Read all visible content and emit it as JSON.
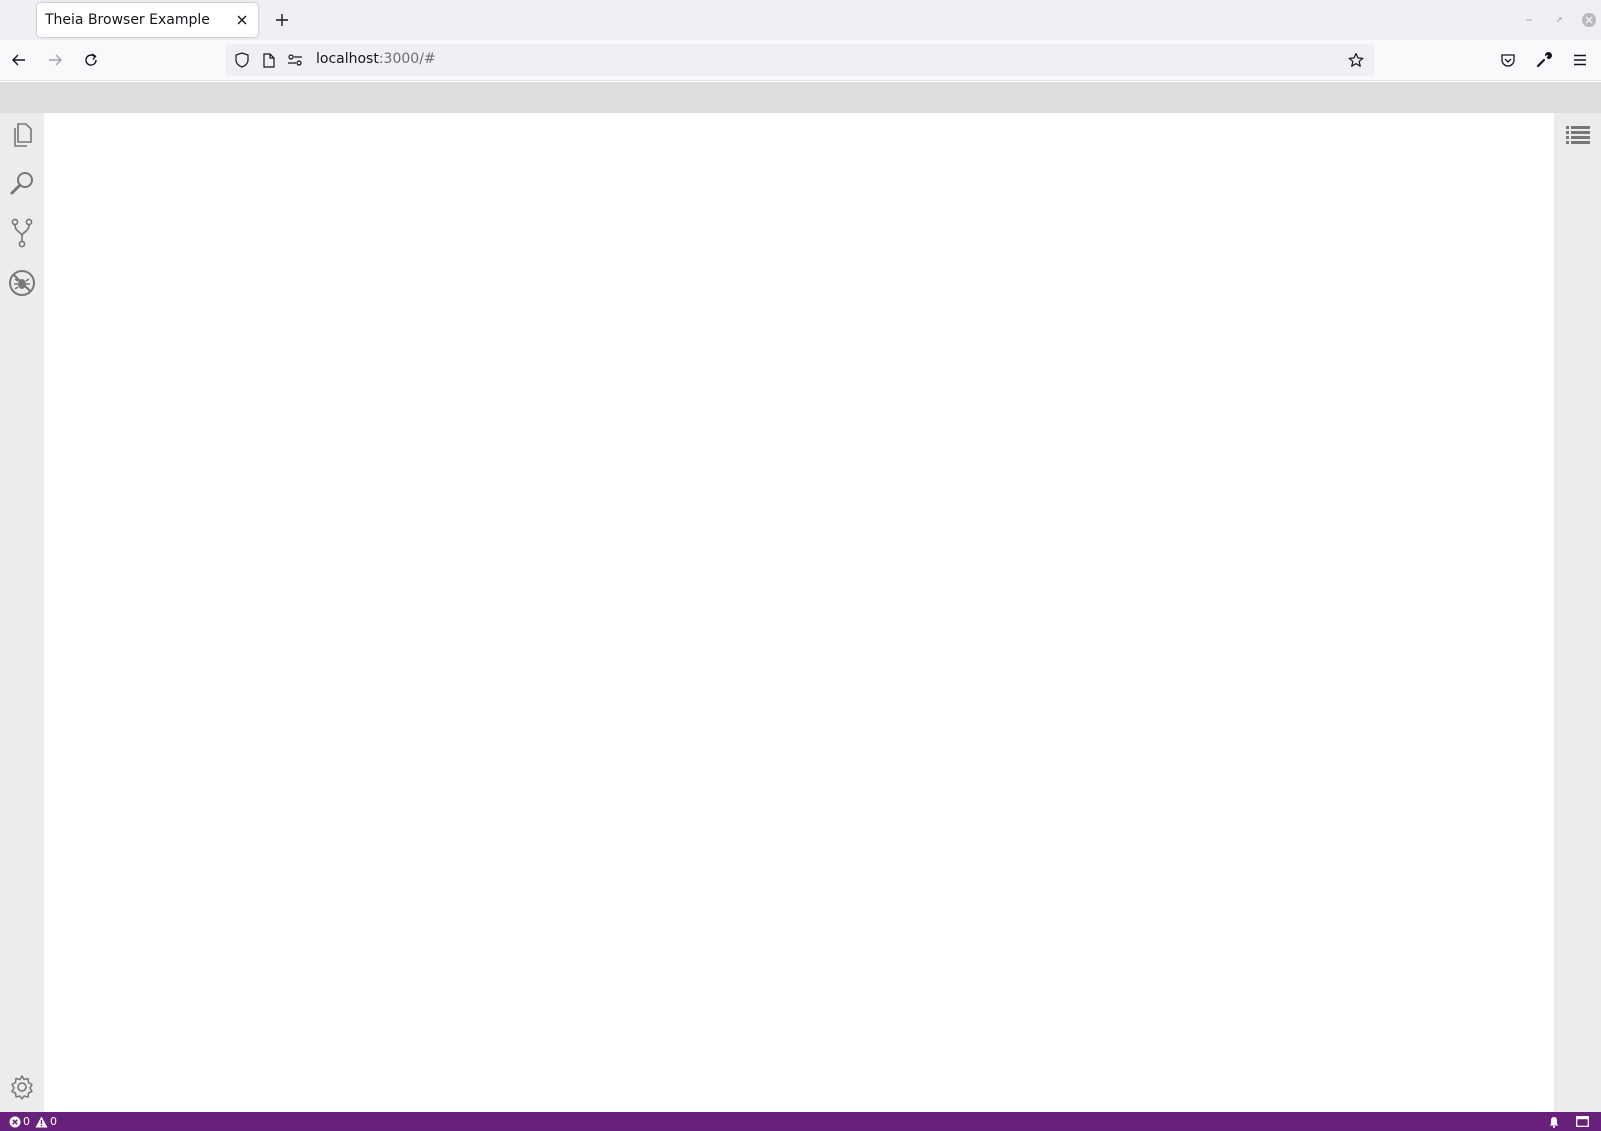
{
  "browser": {
    "tab": {
      "title": "Theia Browser Example"
    },
    "url": {
      "host": "localhost",
      "rest": ":3000/#"
    }
  },
  "statusbar": {
    "errors": "0",
    "warnings": "0"
  },
  "colors": {
    "statusbar": "#68217a",
    "menubar": "#dddddd",
    "sidebar": "#ececec"
  }
}
